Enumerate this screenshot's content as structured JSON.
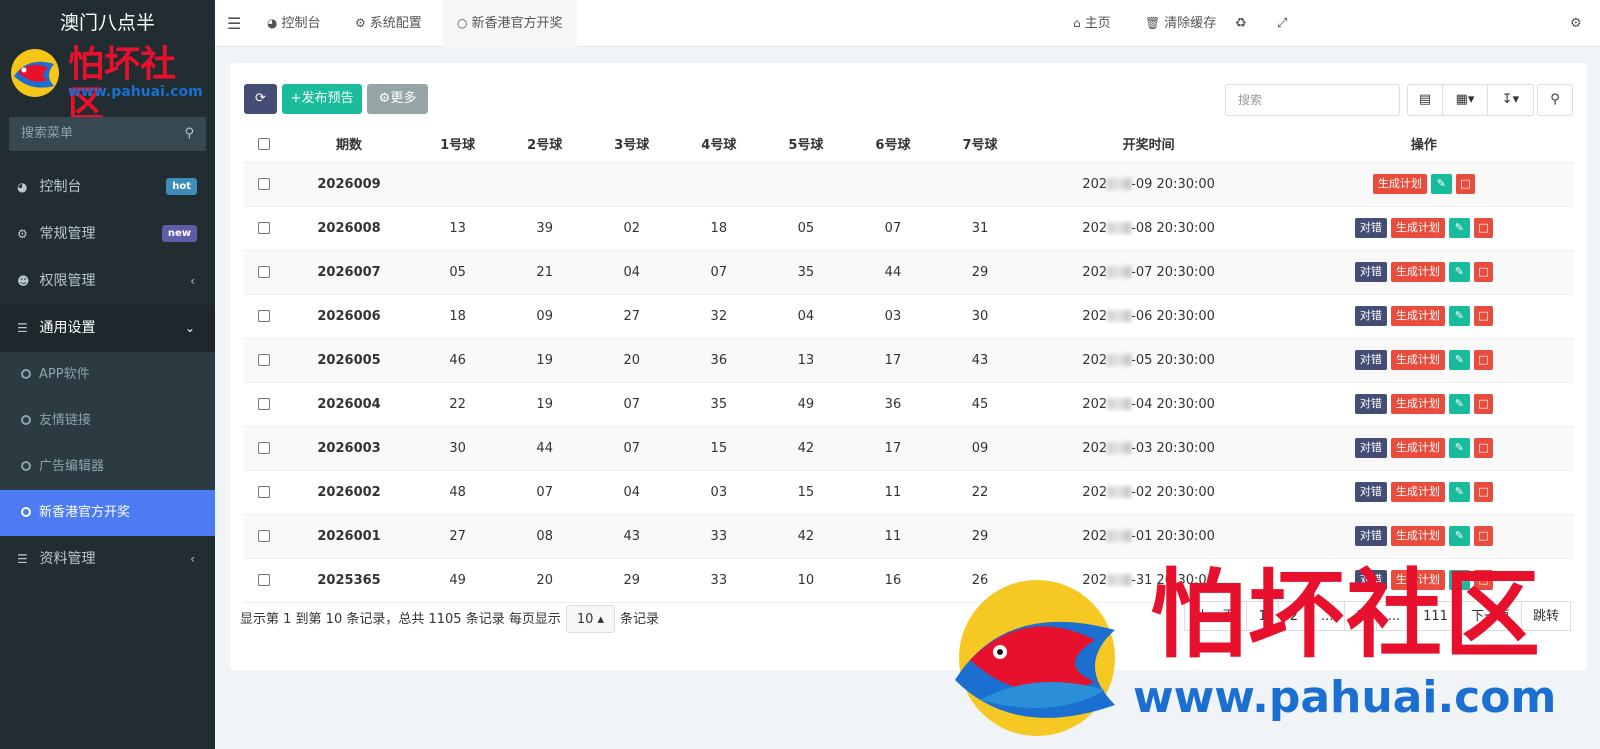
{
  "sidebar": {
    "brand": "澳门八点半",
    "logo_text": "怕坏社区",
    "logo_url": "www.pahuai.com",
    "search_placeholder": "搜索菜单",
    "items": [
      {
        "label": "控制台",
        "badge": "hot",
        "icon": "dashboard-icon"
      },
      {
        "label": "常规管理",
        "badge": "new",
        "icon": "cogs-icon"
      },
      {
        "label": "权限管理",
        "chevron": "‹",
        "icon": "users-icon"
      },
      {
        "label": "通用设置",
        "chevron": "⌄",
        "icon": "list-icon"
      }
    ],
    "sub_items": [
      {
        "label": "APP软件"
      },
      {
        "label": "友情链接"
      },
      {
        "label": "广告编辑器"
      },
      {
        "label": "新香港官方开奖"
      }
    ],
    "bottom_item": {
      "label": "资料管理",
      "chevron": "‹"
    }
  },
  "topbar": {
    "tabs": [
      {
        "label": "控制台"
      },
      {
        "label": "系统配置"
      },
      {
        "label": "新香港官方开奖"
      }
    ],
    "home": "主页",
    "clear_cache": "清除缓存"
  },
  "toolbar": {
    "publish_label": "发布预告",
    "more_label": "更多",
    "search_placeholder": "搜索"
  },
  "table": {
    "columns": [
      "期数",
      "1号球",
      "2号球",
      "3号球",
      "4号球",
      "5号球",
      "6号球",
      "7号球",
      "开奖时间",
      "操作"
    ],
    "rows": [
      {
        "issue": "2026009",
        "balls": [
          "",
          "",
          "",
          "",
          "",
          "",
          ""
        ],
        "time_prefix": "202",
        "time_suffix": "-09 20:30:00",
        "has_check": false
      },
      {
        "issue": "2026008",
        "balls": [
          "13",
          "39",
          "02",
          "18",
          "05",
          "07",
          "31"
        ],
        "time_prefix": "202",
        "time_suffix": "-08 20:30:00",
        "has_check": true
      },
      {
        "issue": "2026007",
        "balls": [
          "05",
          "21",
          "04",
          "07",
          "35",
          "44",
          "29"
        ],
        "time_prefix": "202",
        "time_suffix": "-07 20:30:00",
        "has_check": true
      },
      {
        "issue": "2026006",
        "balls": [
          "18",
          "09",
          "27",
          "32",
          "04",
          "03",
          "30"
        ],
        "time_prefix": "202",
        "time_suffix": "-06 20:30:00",
        "has_check": true
      },
      {
        "issue": "2026005",
        "balls": [
          "46",
          "19",
          "20",
          "36",
          "13",
          "17",
          "43"
        ],
        "time_prefix": "202",
        "time_suffix": "-05 20:30:00",
        "has_check": true
      },
      {
        "issue": "2026004",
        "balls": [
          "22",
          "19",
          "07",
          "35",
          "49",
          "36",
          "45"
        ],
        "time_prefix": "202",
        "time_suffix": "-04 20:30:00",
        "has_check": true
      },
      {
        "issue": "2026003",
        "balls": [
          "30",
          "44",
          "07",
          "15",
          "42",
          "17",
          "09"
        ],
        "time_prefix": "202",
        "time_suffix": "-03 20:30:00",
        "has_check": true
      },
      {
        "issue": "2026002",
        "balls": [
          "48",
          "07",
          "04",
          "03",
          "15",
          "11",
          "22"
        ],
        "time_prefix": "202",
        "time_suffix": "-02 20:30:00",
        "has_check": true
      },
      {
        "issue": "2026001",
        "balls": [
          "27",
          "08",
          "43",
          "33",
          "42",
          "11",
          "29"
        ],
        "time_prefix": "202",
        "time_suffix": "-01 20:30:00",
        "has_check": true
      },
      {
        "issue": "2025365",
        "balls": [
          "49",
          "20",
          "29",
          "33",
          "10",
          "16",
          "26"
        ],
        "time_prefix": "202",
        "time_suffix": "-31 20:30:00",
        "has_check": true
      }
    ],
    "op_check": "对错",
    "op_generate": "生成计划"
  },
  "pager": {
    "info": "显示第 1 到第 10 条记录，总共 1105 条记录 每页显示",
    "page_size": "10",
    "suffix": "条记录",
    "pages": [
      "上一页",
      "1",
      "2",
      "...",
      "5",
      "...",
      "111",
      "下一页",
      "跳转"
    ]
  },
  "watermark": {
    "text": "怕坏社区",
    "url": "www.pahuai.com"
  },
  "colors": {
    "sidebar_bg": "#222d32",
    "active_menu": "#4d7cf2",
    "btn_dark": "#444e74",
    "btn_green": "#1abc9c",
    "btn_red": "#e74c3c",
    "logo_red": "#e8112d",
    "logo_blue": "#1a6fd0"
  }
}
